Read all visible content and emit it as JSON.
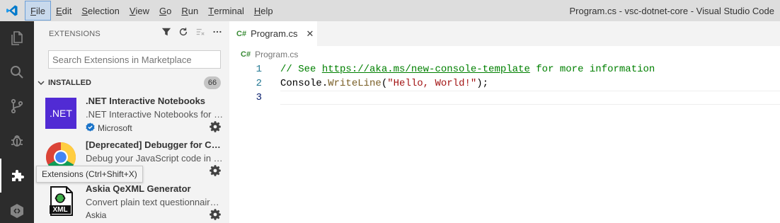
{
  "menu": {
    "items": [
      {
        "accel": "F",
        "rest": "ile"
      },
      {
        "accel": "E",
        "rest": "dit"
      },
      {
        "accel": "S",
        "rest": "election"
      },
      {
        "accel": "V",
        "rest": "iew"
      },
      {
        "accel": "G",
        "rest": "o"
      },
      {
        "accel": "R",
        "rest": "un"
      },
      {
        "accel": "T",
        "rest": "erminal"
      },
      {
        "accel": "H",
        "rest": "elp"
      }
    ]
  },
  "window": {
    "title": "Program.cs - vsc-dotnet-core - Visual Studio Code"
  },
  "activitybar": {
    "items": [
      "explorer-icon",
      "search-icon",
      "source-control-icon",
      "run-debug-icon",
      "extensions-icon",
      "remote-icon"
    ],
    "active": "extensions-icon",
    "tooltip": "Extensions (Ctrl+Shift+X)"
  },
  "sidebar": {
    "title": "EXTENSIONS",
    "search_placeholder": "Search Extensions in Marketplace",
    "section": {
      "label": "INSTALLED",
      "count": "66"
    },
    "extensions": [
      {
        "name": ".NET Interactive Notebooks",
        "description": ".NET Interactive Notebooks for .NET",
        "publisher": "Microsoft",
        "verified": true,
        "icon": "dotnet-logo-icon",
        "icon_text": ".NET"
      },
      {
        "name": "[Deprecated] Debugger for Chrome",
        "description": "Debug your JavaScript code in the Chrome browser",
        "publisher": "",
        "verified": false,
        "icon": "chrome-logo-icon"
      },
      {
        "name": "Askia QeXML Generator",
        "description": "Convert plain text questionnaire to QeXML",
        "publisher": "Askia",
        "verified": false,
        "icon": "xml-file-icon",
        "icon_text": "XML"
      }
    ]
  },
  "editor": {
    "tab": {
      "label": "Program.cs",
      "lang_glyph": "C#"
    },
    "breadcrumb": {
      "file": "Program.cs",
      "lang_glyph": "C#"
    },
    "lines": [
      {
        "number": "1",
        "comment_prefix": "// See ",
        "link": "https://aka.ms/new-console-template",
        "comment_suffix": " for more information"
      },
      {
        "number": "2",
        "class_name": "Console",
        "dot": ".",
        "method": "WriteLine",
        "open": "(",
        "string": "\"Hello, World!\"",
        "close": ");"
      },
      {
        "number": "3"
      }
    ]
  },
  "colors": {
    "activity_bar": "#2c2c2c",
    "sidebar": "#f3f3f3",
    "title_bar": "#dddddd",
    "accent": "#007acc",
    "dotnet_purple": "#512bd4"
  }
}
